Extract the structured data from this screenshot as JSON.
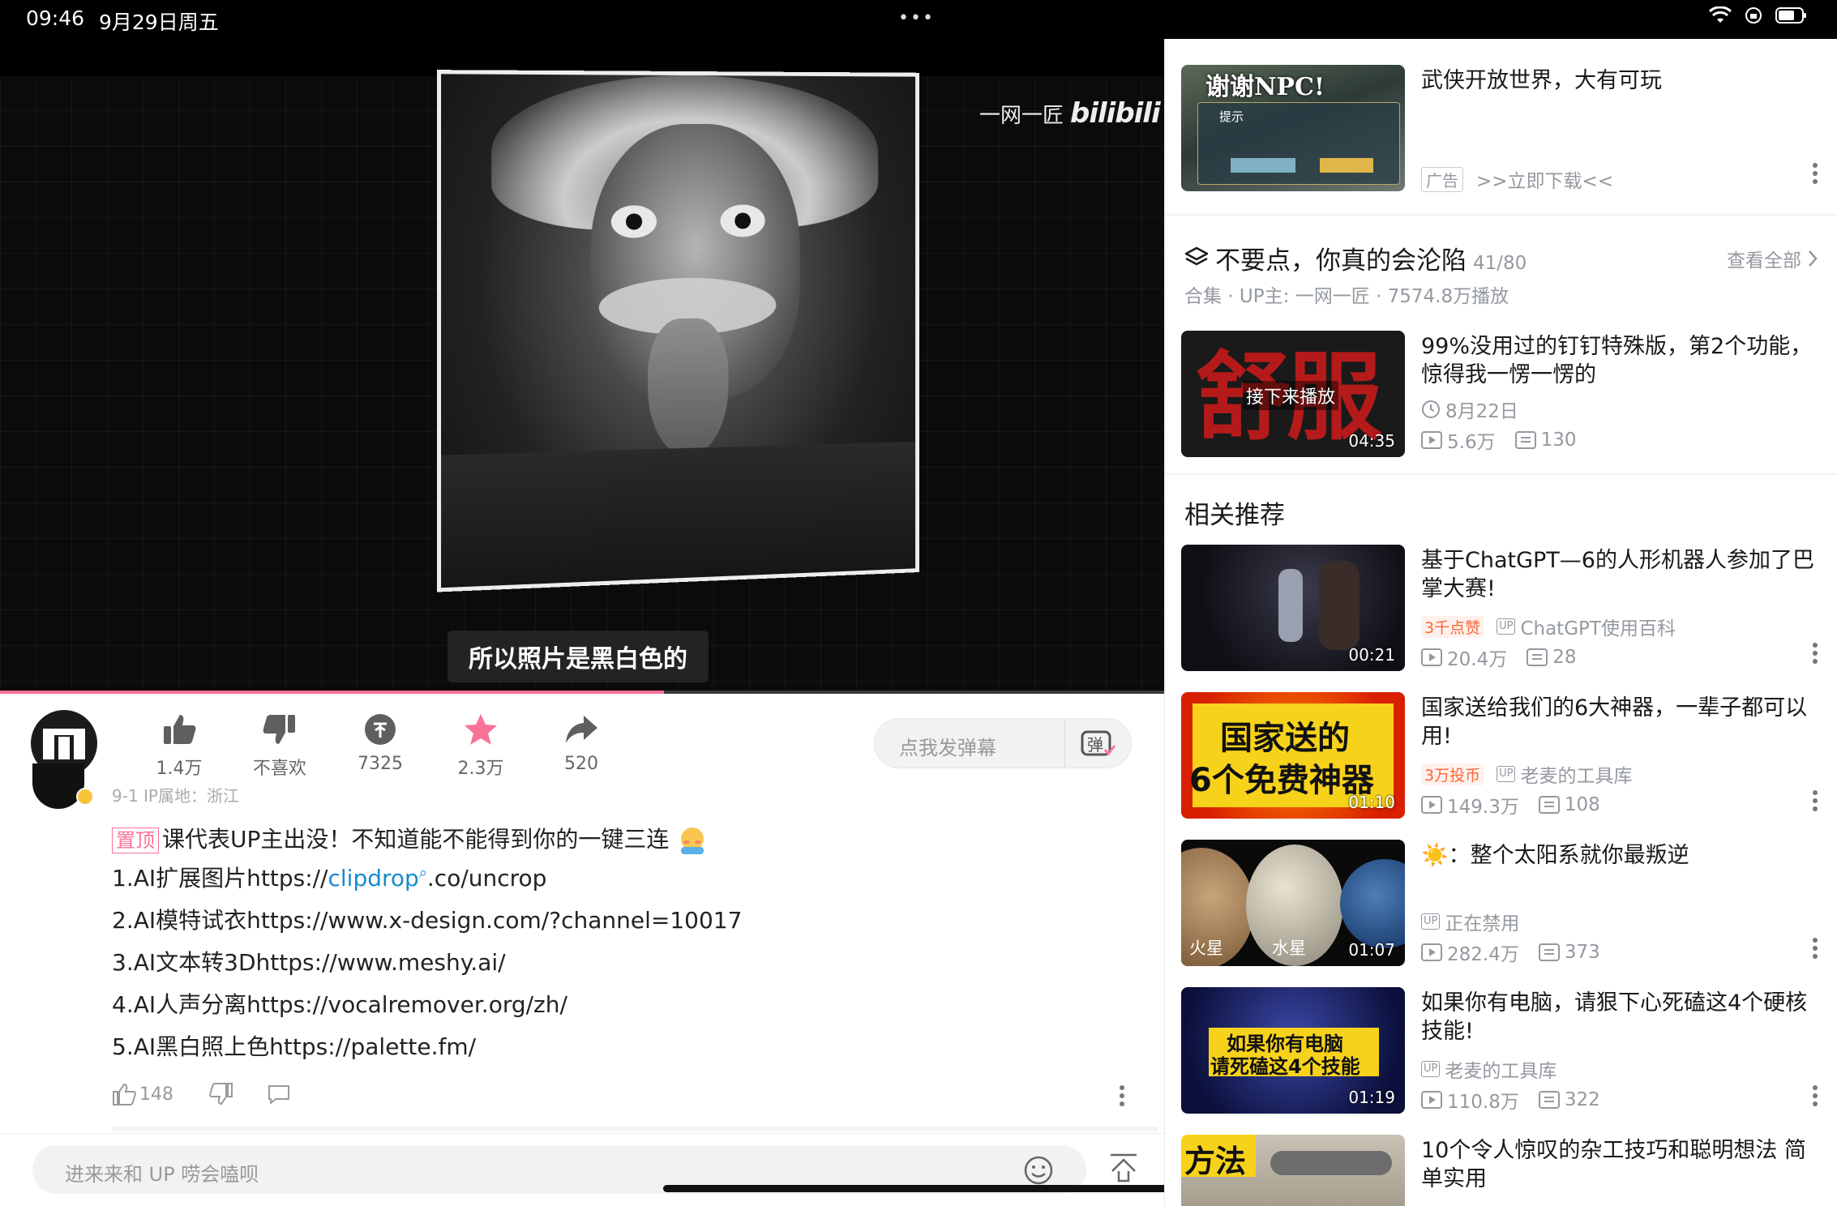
{
  "status_bar": {
    "time": "09:46",
    "date": "9月29日周五",
    "dots": "•••"
  },
  "video": {
    "watermark_channel": "一网一匠",
    "watermark_logo": "bilibili",
    "subtitle": "所以照片是黑白色的",
    "progress_percent": 57
  },
  "actions": {
    "like": "1.4万",
    "dislike": "不喜欢",
    "coin": "7325",
    "favorite": "2.3万",
    "share": "520"
  },
  "danmaku": {
    "placeholder": "点我发弹幕",
    "button": "弹"
  },
  "comment": {
    "meta": "9-1 IP属地：浙江",
    "pin_tag": "置顶",
    "line0": "课代表UP主出没！不知道能不能得到你的一键三连",
    "line1_prefix": "1.AI扩展图片https://",
    "line1_link": "clipdrop",
    "line1_suffix": ".co/uncrop",
    "line2": "2.AI模特试衣https://www.x-design.com/?channel=10017",
    "line3": "3.AI文本转3Dhttps://www.meshy.ai/",
    "line4": "4.AI人声分离https://vocalremover.org/zh/",
    "line5": "5.AI黑白照上色https://palette.fm/",
    "likes": "148"
  },
  "input": {
    "placeholder": "进来来和 UP 唠会嗑呗"
  },
  "right": {
    "ad": {
      "title": "武侠开放世界，大有可玩",
      "tag": "广告",
      "cta": ">>立即下载<<",
      "thumb_title": "谢谢NPC!",
      "thumb_sub": "提示"
    },
    "collection": {
      "title": "不要点，你真的会沦陷",
      "count": "41/80",
      "view_all": "查看全部",
      "meta": "合集 · UP主: 一网一匠 · 7574.8万播放"
    },
    "next": {
      "thumb_text": "舒服",
      "overlay": "接下来播放",
      "duration": "04:35",
      "title": "99%没用过的钉钉特殊版，第2个功能，惊得我一愣一愣的",
      "date": "8月22日",
      "views": "5.6万",
      "danmaku": "130"
    },
    "related_title": "相关推荐",
    "related": [
      {
        "title": "基于ChatGPT—6的人形机器人参加了巴掌大赛!",
        "hot": "3千点赞",
        "up": "ChatGPT使用百科",
        "views": "20.4万",
        "danmaku": "28",
        "duration": "00:21"
      },
      {
        "title": "国家送给我们的6大神器，一辈子都可以用!",
        "hot": "3万投币",
        "up": "老麦的工具库",
        "views": "149.3万",
        "danmaku": "108",
        "duration": "01:10",
        "thumb_line1": "国家送的",
        "thumb_line2": "6个免费神器"
      },
      {
        "title": "☀️：整个太阳系就你最叛逆",
        "hot": "",
        "up": "正在禁用",
        "views": "282.4万",
        "danmaku": "373",
        "duration": "01:07",
        "thumb_label1": "火星",
        "thumb_label2": "水星"
      },
      {
        "title": "如果你有电脑，请狠下心死磕这4个硬核技能!",
        "hot": "",
        "up": "老麦的工具库",
        "views": "110.8万",
        "danmaku": "322",
        "duration": "01:19",
        "thumb_line1": "如果你有电脑",
        "thumb_line2": "请死磕这4个技能"
      },
      {
        "title": "10个令人惊叹的杂工技巧和聪明想法 简单实用",
        "thumb_text": "方法"
      }
    ]
  },
  "colors": {
    "accent_pink": "#fb7299",
    "link_blue": "#178bcf",
    "meta_gray": "#9499a0"
  }
}
